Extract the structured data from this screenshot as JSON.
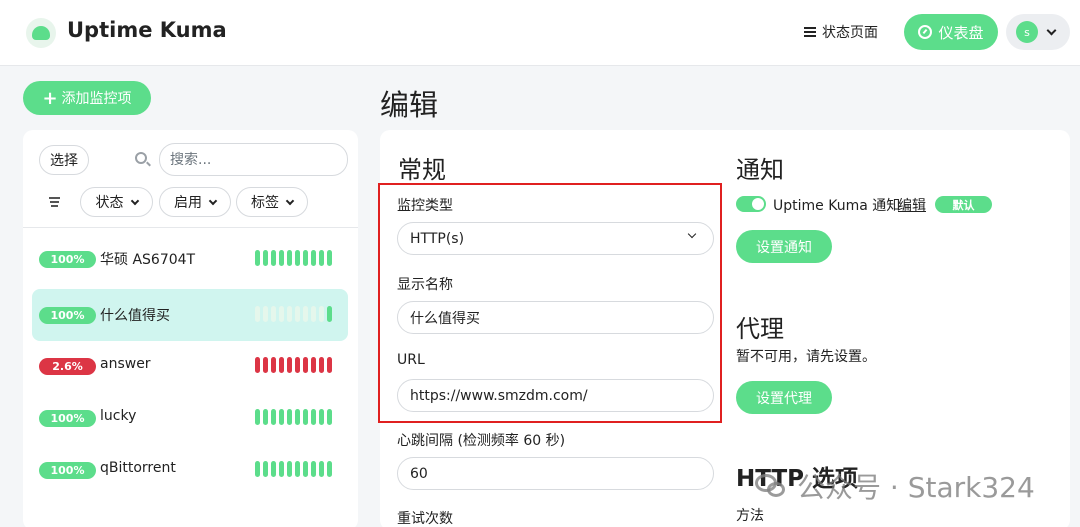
{
  "header": {
    "brand": "Uptime Kuma",
    "status_page_label": "状态页面",
    "dashboard_label": "仪表盘",
    "avatar_letter": "s"
  },
  "sidebar": {
    "add_button": "添加监控项",
    "select_label": "选择",
    "search_placeholder": "搜索...",
    "filters": [
      "状态",
      "启用",
      "标签"
    ],
    "monitors": [
      {
        "uptime": "100%",
        "name": "华硕 AS6704T",
        "status": "up",
        "beats": [
          "up",
          "up",
          "up",
          "up",
          "up",
          "up",
          "up",
          "up",
          "up",
          "up"
        ]
      },
      {
        "uptime": "100%",
        "name": "什么值得买",
        "status": "up",
        "beats": [
          "empty",
          "empty",
          "empty",
          "empty",
          "empty",
          "empty",
          "empty",
          "empty",
          "empty",
          "up"
        ]
      },
      {
        "uptime": "2.6%",
        "name": "answer",
        "status": "down",
        "beats": [
          "down",
          "down",
          "down",
          "down",
          "down",
          "down",
          "down",
          "down",
          "down",
          "down"
        ]
      },
      {
        "uptime": "100%",
        "name": "lucky",
        "status": "up",
        "beats": [
          "up",
          "up",
          "up",
          "up",
          "up",
          "up",
          "up",
          "up",
          "up",
          "up"
        ]
      },
      {
        "uptime": "100%",
        "name": "qBittorrent",
        "status": "up",
        "beats": [
          "up",
          "up",
          "up",
          "up",
          "up",
          "up",
          "up",
          "up",
          "up",
          "up"
        ]
      }
    ]
  },
  "main": {
    "page_title": "编辑",
    "general_title": "常规",
    "monitor_type_label": "监控类型",
    "monitor_type_value": "HTTP(s)",
    "display_name_label": "显示名称",
    "display_name_value": "什么值得买",
    "url_label": "URL",
    "url_value": "https://www.smzdm.com/",
    "heartbeat_label": "心跳间隔 (检测频率 60 秒)",
    "heartbeat_value": "60",
    "retries_label": "重试次数",
    "notify_title": "通知",
    "notify_name": "Uptime Kuma 通知",
    "notify_edit": "编辑",
    "notify_default": "默认",
    "setup_notify_button": "设置通知",
    "proxy_title": "代理",
    "proxy_text": "暂不可用，请先设置。",
    "setup_proxy_button": "设置代理",
    "http_options_title": "HTTP 选项",
    "method_label": "方法"
  },
  "watermark": "公众号 · Stark324",
  "colors": {
    "accent": "#5cdd8b",
    "danger": "#dc3545",
    "highlight": "#e02020",
    "selected_row": "#d0f5ef"
  }
}
